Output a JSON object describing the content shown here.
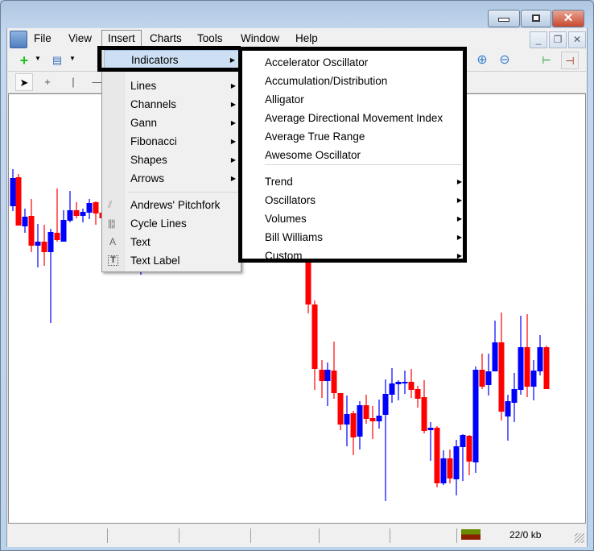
{
  "menubar": {
    "items": [
      "File",
      "View",
      "Insert",
      "Charts",
      "Tools",
      "Window",
      "Help"
    ]
  },
  "insert_menu": {
    "items": [
      {
        "label": "Indicators",
        "submenu": true,
        "highlighted": true
      },
      {
        "label": "Lines",
        "submenu": true
      },
      {
        "label": "Channels",
        "submenu": true
      },
      {
        "label": "Gann",
        "submenu": true
      },
      {
        "label": "Fibonacci",
        "submenu": true
      },
      {
        "label": "Shapes",
        "submenu": true
      },
      {
        "label": "Arrows",
        "submenu": true
      },
      {
        "label": "Andrews' Pitchfork",
        "icon": "pitchfork-icon"
      },
      {
        "label": "Cycle Lines",
        "icon": "cycle-lines-icon"
      },
      {
        "label": "Text",
        "icon": "text-icon",
        "glyph": "A"
      },
      {
        "label": "Text Label",
        "icon": "text-label-icon",
        "glyph": "T"
      }
    ]
  },
  "indicators_submenu": {
    "items": [
      "Accelerator Oscillator",
      "Accumulation/Distribution",
      "Alligator",
      "Average Directional Movement Index",
      "Average True Range",
      "Awesome Oscillator"
    ],
    "groups": [
      "Trend",
      "Oscillators",
      "Volumes",
      "Bill Williams",
      "Custom"
    ]
  },
  "status": {
    "traffic": "22/0 kb"
  },
  "colors": {
    "bull": "#0000ff",
    "bear": "#ff0000",
    "highlight": "#cddff2",
    "annotation": "#000000"
  },
  "icons": {
    "arrow": "▸"
  }
}
